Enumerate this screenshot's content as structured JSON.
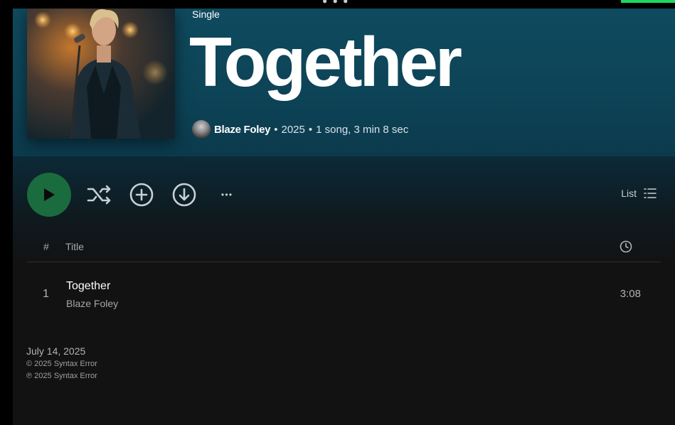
{
  "album": {
    "type_label": "Single",
    "title": "Together",
    "artist": "Blaze Foley",
    "year": "2025",
    "summary": "1 song, 3 min 8 sec",
    "separator": "•"
  },
  "controls": {
    "play_icon": "play-icon",
    "shuffle_icon": "shuffle-icon",
    "add_icon": "add-circle-icon",
    "download_icon": "download-icon",
    "more_icon": "more-options-icon",
    "more_glyph": "• • •",
    "view_label": "List",
    "view_icon": "list-view-icon"
  },
  "table": {
    "num_header": "#",
    "title_header": "Title",
    "duration_icon": "clock-icon",
    "tracks": [
      {
        "number": "1",
        "title": "Together",
        "artist": "Blaze Foley",
        "duration": "3:08"
      }
    ]
  },
  "footer": {
    "release_date": "July 14, 2025",
    "copyright": "© 2025 Syntax Error",
    "phonographic": "℗ 2025 Syntax Error"
  },
  "colors": {
    "accent": "#1ed760",
    "play_button": "#1a6b3d",
    "hero_bg": "#0f4a5e",
    "page_bg": "#121212"
  }
}
